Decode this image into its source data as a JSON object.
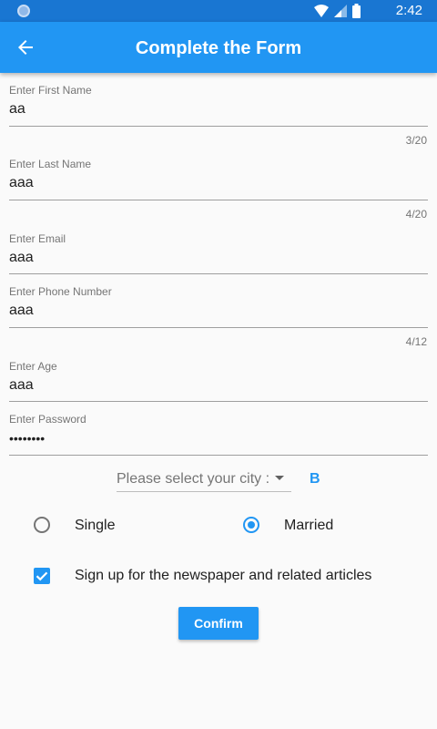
{
  "status_bar": {
    "time": "2:42"
  },
  "app_bar": {
    "title": "Complete the Form",
    "back_icon": "arrow-back-icon"
  },
  "form": {
    "first_name": {
      "label": "Enter First Name",
      "value": "aa",
      "counter": "3/20"
    },
    "last_name": {
      "label": "Enter Last Name",
      "value": "aaa",
      "counter": "4/20"
    },
    "email": {
      "label": "Enter Email",
      "value": "aaa"
    },
    "phone": {
      "label": "Enter Phone Number",
      "value": "aaa",
      "counter": "4/12"
    },
    "age": {
      "label": "Enter Age",
      "value": "aaa"
    },
    "password": {
      "label": "Enter Password",
      "value": "••••••••"
    },
    "city": {
      "placeholder": "Please select your city :",
      "selected": "B"
    },
    "marital_status": {
      "options": [
        {
          "label": "Single",
          "checked": false
        },
        {
          "label": "Married",
          "checked": true
        }
      ]
    },
    "newsletter": {
      "label": "Sign up for the newspaper and related articles",
      "checked": true
    },
    "confirm_label": "Confirm"
  },
  "colors": {
    "primary": "#2196f3",
    "status_bar": "#1976d2",
    "background": "#fafafa"
  }
}
